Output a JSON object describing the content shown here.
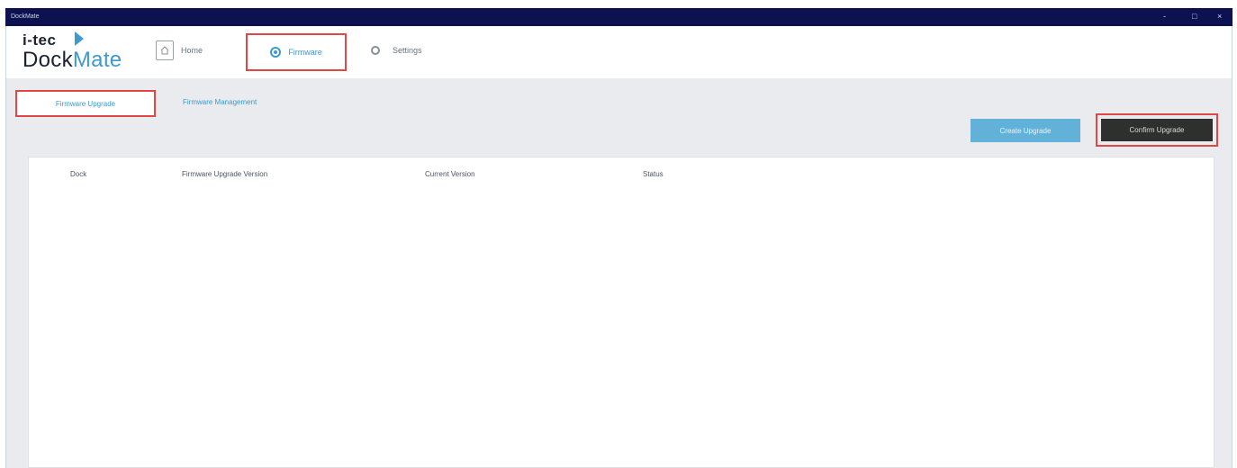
{
  "window": {
    "title": "DockMate",
    "controls": {
      "minimize": "-",
      "maximize": "□",
      "close": "×"
    }
  },
  "logo": {
    "brand": "i-tec",
    "name_dock": "Dock",
    "name_mate": "Mate"
  },
  "nav": {
    "home": {
      "label": "Home",
      "icon": "home-icon"
    },
    "firmware": {
      "label": "Firmware",
      "icon": "firmware-icon",
      "active": true
    },
    "settings": {
      "label": "Settings",
      "icon": "settings-icon"
    }
  },
  "subtabs": {
    "firmware_upgrade": "Firmware Upgrade",
    "firmware_management": "Firmware Management"
  },
  "buttons": {
    "create_upgrade": "Create Upgrade",
    "confirm_upgrade": "Confirm Upgrade"
  },
  "table": {
    "columns": [
      "Dock",
      "Firmware Upgrade Version",
      "Current Version",
      "Status"
    ],
    "rows": []
  },
  "colors": {
    "titlebar": "#0c1250",
    "accent": "#3d9ad0",
    "highlight": "#e04848",
    "dark_button": "#2d302f"
  }
}
